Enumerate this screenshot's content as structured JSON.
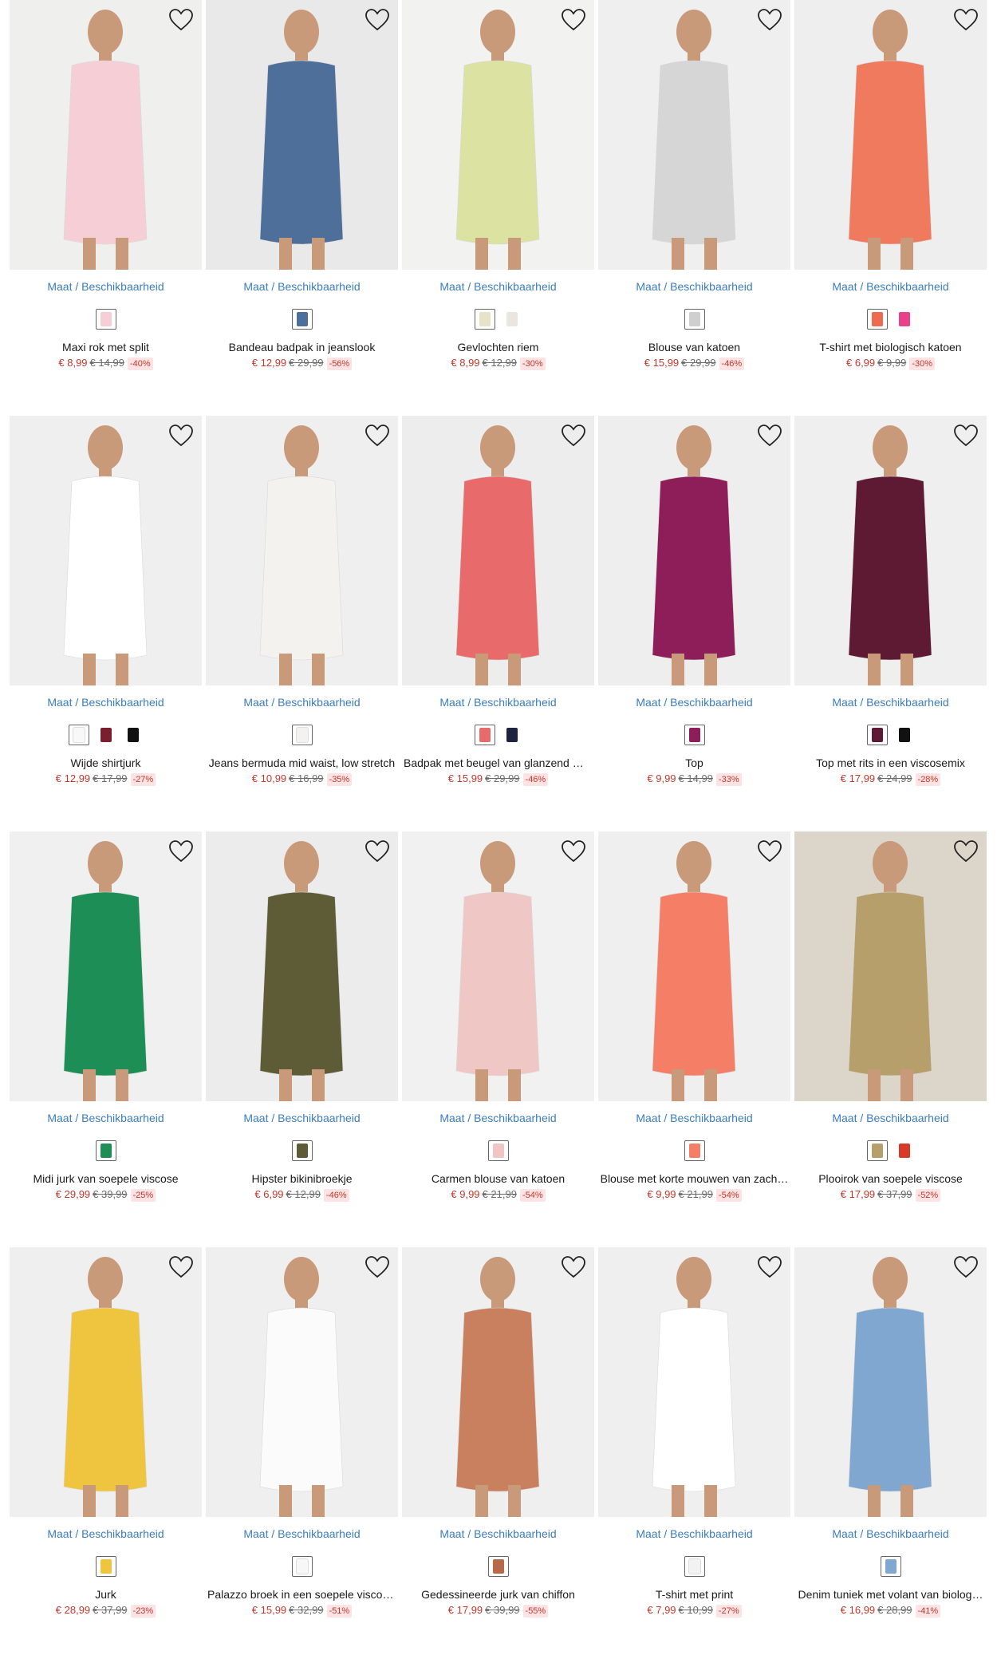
{
  "ui": {
    "availability_label": "Maat / Beschikbaarheid",
    "wishlist_icon": "heart-outline-icon"
  },
  "products": [
    {
      "name": "Maxi rok met split",
      "price": "€ 8,99",
      "old_price": "€ 14,99",
      "discount": "-40%",
      "photo_bg": "#efefee",
      "garment": "#f6cfd6",
      "swatches": [
        "#f6cfd6"
      ]
    },
    {
      "name": "Bandeau badpak in jeanslook",
      "price": "€ 12,99",
      "old_price": "€ 29,99",
      "discount": "-56%",
      "photo_bg": "#e9e9ea",
      "garment": "#4e6f99",
      "swatches": [
        "#4e6f99"
      ]
    },
    {
      "name": "Gevlochten riem",
      "price": "€ 8,99",
      "old_price": "€ 12,99",
      "discount": "-30%",
      "photo_bg": "#f2f2f0",
      "garment": "#dbe2a2",
      "swatches": [
        "#e8e2c8",
        "#e8e6de"
      ]
    },
    {
      "name": "Blouse van katoen",
      "price": "€ 15,99",
      "old_price": "€ 29,99",
      "discount": "-46%",
      "photo_bg": "#efefef",
      "garment": "#d6d6d6",
      "swatches": [
        "#cfcfcf"
      ]
    },
    {
      "name": "T-shirt met biologisch katoen",
      "price": "€ 6,99",
      "old_price": "€ 9,99",
      "discount": "-30%",
      "photo_bg": "#eeeeee",
      "garment": "#ef7a5e",
      "swatches": [
        "#ef6a4e",
        "#e8418a"
      ]
    },
    {
      "name": "Wijde shirtjurk",
      "price": "€ 12,99",
      "old_price": "€ 17,99",
      "discount": "-27%",
      "photo_bg": "#efefef",
      "garment": "#ffffff",
      "swatches": [
        "#f8f8f8",
        "#7a1f2e",
        "#111111"
      ]
    },
    {
      "name": "Jeans bermuda mid waist, low stretch",
      "price": "€ 10,99",
      "old_price": "€ 16,99",
      "discount": "-35%",
      "photo_bg": "#efefef",
      "garment": "#f4f2ee",
      "swatches": [
        "#f4f2ee"
      ]
    },
    {
      "name": "Badpak met beugel van glanzend m…",
      "price": "€ 15,99",
      "old_price": "€ 29,99",
      "discount": "-46%",
      "photo_bg": "#ededed",
      "garment": "#e86a6a",
      "swatches": [
        "#e86a6a",
        "#1e2440"
      ]
    },
    {
      "name": "Top",
      "price": "€ 9,99",
      "old_price": "€ 14,99",
      "discount": "-33%",
      "photo_bg": "#eeeeee",
      "garment": "#8e1e5a",
      "swatches": [
        "#8e1e5a"
      ]
    },
    {
      "name": "Top met rits in een viscosemix",
      "price": "€ 17,99",
      "old_price": "€ 24,99",
      "discount": "-28%",
      "photo_bg": "#efefef",
      "garment": "#5e1a33",
      "swatches": [
        "#5e1a33",
        "#111111"
      ]
    },
    {
      "name": "Midi jurk van soepele viscose",
      "price": "€ 29,99",
      "old_price": "€ 39,99",
      "discount": "-25%",
      "photo_bg": "#f0f0f0",
      "garment": "#1d8f56",
      "swatches": [
        "#1d8f56"
      ]
    },
    {
      "name": "Hipster bikinibroekje",
      "price": "€ 6,99",
      "old_price": "€ 12,99",
      "discount": "-46%",
      "photo_bg": "#ececec",
      "garment": "#5d5c36",
      "swatches": [
        "#5d5c36"
      ]
    },
    {
      "name": "Carmen blouse van katoen",
      "price": "€ 9,99",
      "old_price": "€ 21,99",
      "discount": "-54%",
      "photo_bg": "#f1f1f1",
      "garment": "#efc8c6",
      "swatches": [
        "#f0c6c4"
      ]
    },
    {
      "name": "Blouse met korte mouwen van zach…",
      "price": "€ 9,99",
      "old_price": "€ 21,99",
      "discount": "-54%",
      "photo_bg": "#efefef",
      "garment": "#f47f66",
      "swatches": [
        "#f47f66"
      ]
    },
    {
      "name": "Plooirok van soepele viscose",
      "price": "€ 17,99",
      "old_price": "€ 37,99",
      "discount": "-52%",
      "photo_bg": "#dcd5ca",
      "garment": "#b69f6a",
      "swatches": [
        "#b69f6a",
        "#d83a2a"
      ]
    },
    {
      "name": "Jurk",
      "price": "€ 28,99",
      "old_price": "€ 37,99",
      "discount": "-23%",
      "photo_bg": "#efefef",
      "garment": "#efc53f",
      "swatches": [
        "#efc53f"
      ]
    },
    {
      "name": "Palazzo broek in een soepele viscos…",
      "price": "€ 15,99",
      "old_price": "€ 32,99",
      "discount": "-51%",
      "photo_bg": "#efefef",
      "garment": "#fbfbfb",
      "swatches": [
        "#f7f7f7"
      ]
    },
    {
      "name": "Gedessineerde jurk van chiffon",
      "price": "€ 17,99",
      "old_price": "€ 39,99",
      "discount": "-55%",
      "photo_bg": "#efefef",
      "garment": "#c9805e",
      "swatches": [
        "#b86a48"
      ]
    },
    {
      "name": "T-shirt met print",
      "price": "€ 7,99",
      "old_price": "€ 10,99",
      "discount": "-27%",
      "photo_bg": "#efefef",
      "garment": "#ffffff",
      "swatches": [
        "#f2f2f2"
      ]
    },
    {
      "name": "Denim tuniek met volant van biolog…",
      "price": "€ 16,99",
      "old_price": "€ 28,99",
      "discount": "-41%",
      "photo_bg": "#efefef",
      "garment": "#7fa7cf",
      "swatches": [
        "#7fa7cf"
      ]
    }
  ]
}
